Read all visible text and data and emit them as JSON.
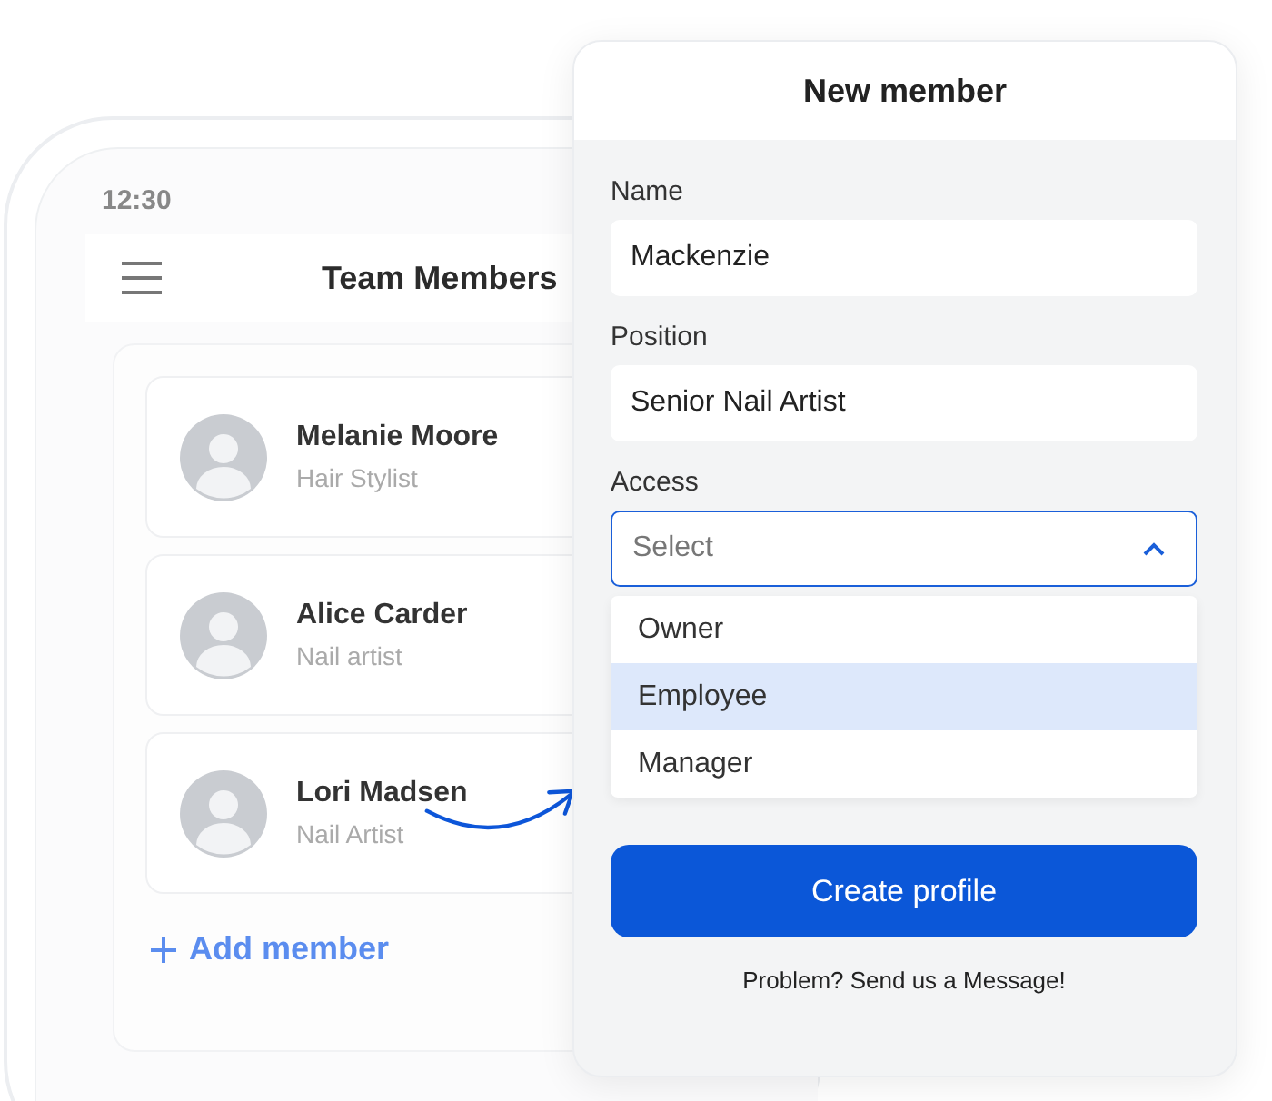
{
  "phone": {
    "time": "12:30",
    "title": "Team Members",
    "members": [
      {
        "name": "Melanie Moore",
        "role": "Hair Stylist"
      },
      {
        "name": "Alice Carder",
        "role": "Nail artist"
      },
      {
        "name": "Lori Madsen",
        "role": "Nail Artist"
      }
    ],
    "add_label": "Add member"
  },
  "dialog": {
    "title": "New member",
    "fields": [
      {
        "kind": "input",
        "label": "Name",
        "value": "Mackenzie"
      },
      {
        "kind": "input",
        "label": "Position",
        "value": "Senior Nail Artist"
      },
      {
        "kind": "select",
        "label": "Access",
        "placeholder": "Select",
        "expanded": true,
        "options": [
          {
            "label": "Owner",
            "selected": false
          },
          {
            "label": "Employee",
            "selected": true
          },
          {
            "label": "Manager",
            "selected": false
          }
        ]
      }
    ],
    "button": "Create profile",
    "footer": "Problem? Send us a Message!"
  }
}
